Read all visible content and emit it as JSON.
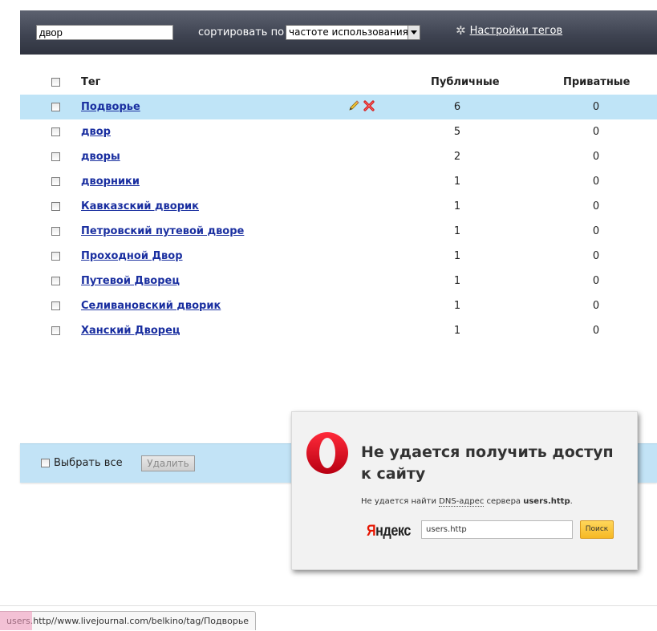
{
  "toolbar": {
    "search_value": "двор",
    "sort_label": "сортировать по",
    "sort_selected": "частоте использования",
    "settings_label": "Настройки тегов"
  },
  "table": {
    "headers": {
      "tag": "Тег",
      "public": "Публичные",
      "private": "Приватные"
    },
    "rows": [
      {
        "tag": "Подворье",
        "public": "6",
        "private": "0"
      },
      {
        "tag": "двор",
        "public": "5",
        "private": "0"
      },
      {
        "tag": "дворы",
        "public": "2",
        "private": "0"
      },
      {
        "tag": "дворники",
        "public": "1",
        "private": "0"
      },
      {
        "tag": "Кавказский дворик",
        "public": "1",
        "private": "0"
      },
      {
        "tag": "Петровский путевой дворе",
        "public": "1",
        "private": "0"
      },
      {
        "tag": "Проходной Двор",
        "public": "1",
        "private": "0"
      },
      {
        "tag": "Путевой Дворец",
        "public": "1",
        "private": "0"
      },
      {
        "tag": "Селивановский дворик",
        "public": "1",
        "private": "0"
      },
      {
        "tag": "Ханский Дворец",
        "public": "1",
        "private": "0"
      }
    ]
  },
  "bottom_bar": {
    "select_all_label": "Выбрать все",
    "delete_label": "Удалить"
  },
  "error_popup": {
    "title": "Не удается получить доступ к сайту",
    "message_prefix": "Не удается найти ",
    "message_dns": "DNS-адрес",
    "message_middle": " сервера ",
    "message_host": "users.http",
    "message_suffix": ".",
    "yandex_logo_first": "Я",
    "yandex_logo_rest": "ндекс",
    "search_value": "users.http",
    "search_button": "Поиск"
  },
  "status_bar": {
    "url": "users.http//www.livejournal.com/belkino/tag/Подворье"
  },
  "colors": {
    "toolbar_bg": "#3f4452",
    "row_highlight": "#bfe4f7",
    "link": "#1a2fa0",
    "bottom_bar_bg": "#c2e3f6",
    "opera_red": "#e0001b",
    "yandex_red": "#e61400",
    "yandex_button": "#f6b924"
  },
  "icons": {
    "settings": "gear-icon",
    "edit": "pencil-icon",
    "delete": "red-cross-icon",
    "browser": "opera-logo-icon"
  }
}
